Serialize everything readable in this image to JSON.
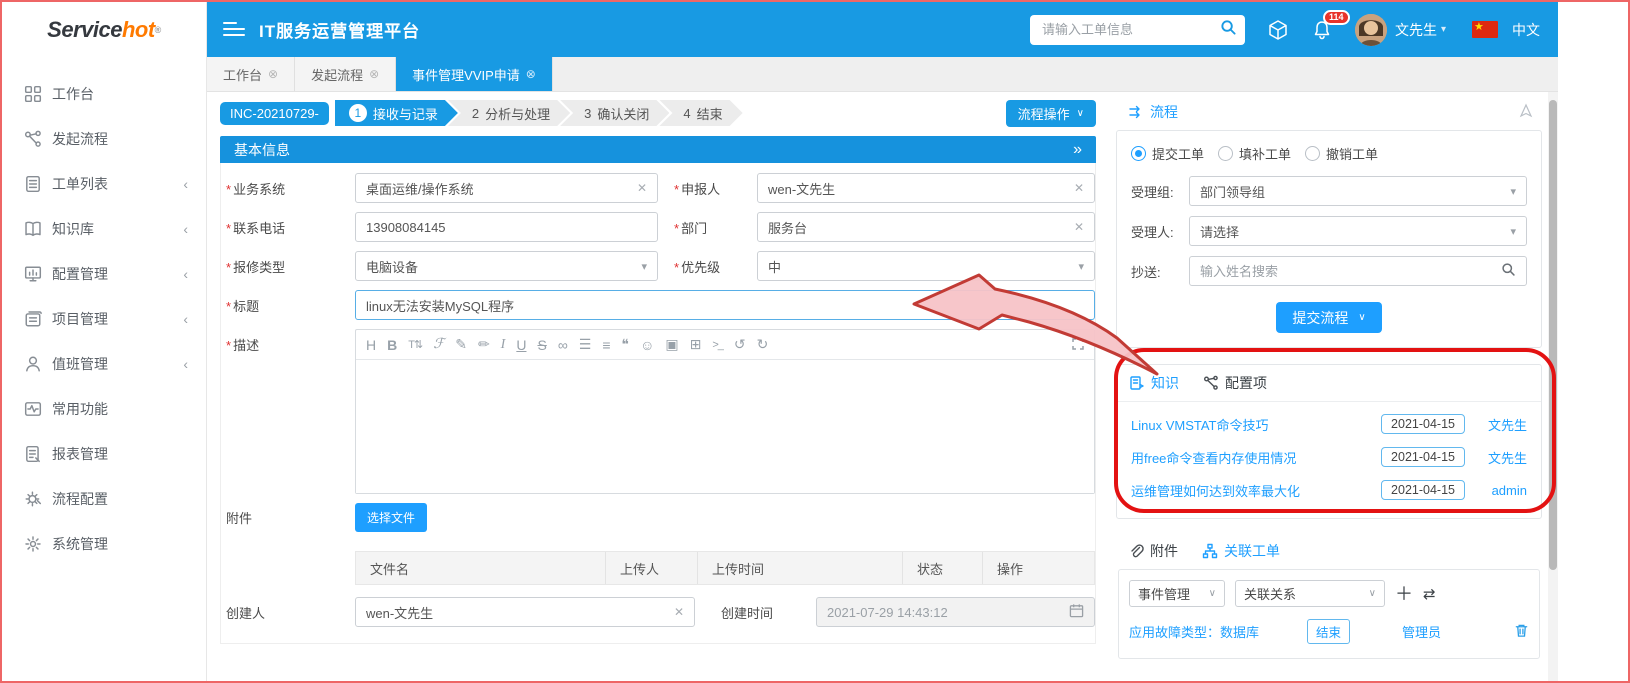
{
  "logo": {
    "part1": "Service",
    "part2": "hot",
    "tm": "®"
  },
  "topbar": {
    "title": "IT服务运营管理平台",
    "search_placeholder": "请输入工单信息",
    "notif_count": "114",
    "user_name": "文先生",
    "lang_label": "中文"
  },
  "sidebar": {
    "items": [
      {
        "label": "工作台",
        "icon": "grid-icon",
        "chevron": ""
      },
      {
        "label": "发起流程",
        "icon": "flow-icon",
        "chevron": ""
      },
      {
        "label": "工单列表",
        "icon": "list-icon",
        "chevron": "‹"
      },
      {
        "label": "知识库",
        "icon": "book-icon",
        "chevron": "‹"
      },
      {
        "label": "配置管理",
        "icon": "monitor-icon",
        "chevron": "‹"
      },
      {
        "label": "项目管理",
        "icon": "project-icon",
        "chevron": "‹"
      },
      {
        "label": "值班管理",
        "icon": "user-icon",
        "chevron": "‹"
      },
      {
        "label": "常用功能",
        "icon": "pulse-icon",
        "chevron": ""
      },
      {
        "label": "报表管理",
        "icon": "report-icon",
        "chevron": ""
      },
      {
        "label": "流程配置",
        "icon": "gear-edit-icon",
        "chevron": ""
      },
      {
        "label": "系统管理",
        "icon": "gear-icon",
        "chevron": ""
      }
    ]
  },
  "tabs": [
    {
      "label": "工作台"
    },
    {
      "label": "发起流程"
    },
    {
      "label": "事件管理VVIP申请"
    }
  ],
  "workflow": {
    "ticket_no": "INC-20210729-",
    "steps": [
      {
        "num": "1",
        "label": "接收与记录"
      },
      {
        "num": "2",
        "label": "分析与处理"
      },
      {
        "num": "3",
        "label": "确认关闭"
      },
      {
        "num": "4",
        "label": "结束"
      }
    ],
    "action_button": "流程操作"
  },
  "form": {
    "section_title": "基本信息",
    "business_system": {
      "label": "业务系统",
      "value": "桌面运维/操作系统"
    },
    "reporter": {
      "label": "申报人",
      "value": "wen-文先生"
    },
    "phone": {
      "label": "联系电话",
      "value": "13908084145"
    },
    "department": {
      "label": "部门",
      "value": "服务台"
    },
    "repair_type": {
      "label": "报修类型",
      "value": "电脑设备"
    },
    "priority": {
      "label": "优先级",
      "value": "中"
    },
    "title": {
      "label": "标题",
      "value": "linux无法安装MySQL程序"
    },
    "description": {
      "label": "描述"
    },
    "attachment": {
      "label": "附件",
      "choose_button": "选择文件",
      "headers": [
        "文件名",
        "上传人",
        "上传时间",
        "状态",
        "操作"
      ]
    },
    "creator": {
      "label": "创建人",
      "value": "wen-文先生"
    },
    "create_time": {
      "label": "创建时间",
      "value": "2021-07-29 14:43:12"
    }
  },
  "editor": {
    "tools": [
      "H",
      "B",
      "T⇅",
      "ℱ",
      "✎",
      "✏",
      "I",
      "U",
      "S",
      "∞",
      "☰",
      "≡",
      "❝",
      "☺",
      "▣",
      "⊞",
      ">_",
      "↺",
      "↻"
    ]
  },
  "flow_panel": {
    "tab": "流程",
    "radios": [
      {
        "label": "提交工单"
      },
      {
        "label": "填补工单"
      },
      {
        "label": "撤销工单"
      }
    ],
    "handle_group": {
      "label": "受理组:",
      "value": "部门领导组"
    },
    "handler": {
      "label": "受理人:",
      "value": "请选择"
    },
    "cc": {
      "label": "抄送:",
      "placeholder": "输入姓名搜索"
    },
    "submit_button": "提交流程"
  },
  "knowledge_panel": {
    "tab_knowledge": "知识",
    "tab_config": "配置项",
    "items": [
      {
        "title": "Linux VMSTAT命令技巧",
        "date": "2021-04-15",
        "author": "文先生"
      },
      {
        "title": "用free命令查看内存使用情况",
        "date": "2021-04-15",
        "author": "文先生"
      },
      {
        "title": "运维管理如何达到效率最大化",
        "date": "2021-04-15",
        "author": "admin"
      }
    ]
  },
  "related_panel": {
    "tab_attachment": "附件",
    "tab_related": "关联工单",
    "type_select": "事件管理",
    "relation_select": "关联关系",
    "row": {
      "title": "应用故障类型：数据库",
      "status": "结束",
      "user": "管理员"
    }
  },
  "colors": {
    "accent": "#1e9fff",
    "header_blue": "#189ae3",
    "annotation_red": "#e31212"
  }
}
